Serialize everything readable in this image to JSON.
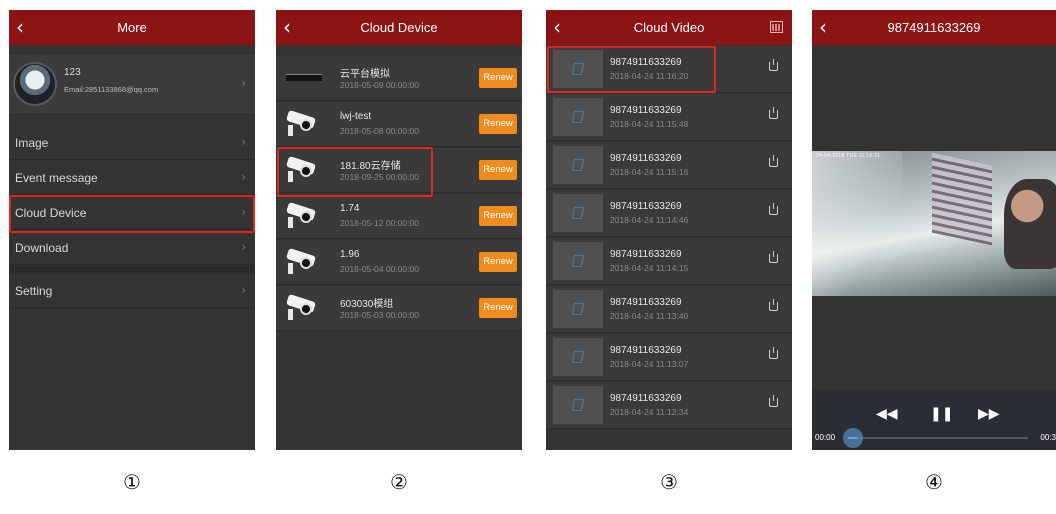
{
  "screens": [
    {
      "title": "More",
      "back_icon": "‹",
      "profile": {
        "name": "123",
        "email": "Email:2851133868@qq.com"
      },
      "menu": [
        "Image",
        "Event message",
        "Cloud Device",
        "Download",
        "Setting"
      ],
      "highlighted": "Cloud Device",
      "step": "①"
    },
    {
      "title": "Cloud Device",
      "back_icon": "‹",
      "devices": [
        {
          "name": "云平台模拟",
          "date": "2018-05-09 00:00:00",
          "action": "Renew",
          "icon": "dvr-icon"
        },
        {
          "name": "lwj-test",
          "date": "2018-05-08 00:00:00",
          "action": "Renew",
          "icon": "camera-icon"
        },
        {
          "name": "181.80云存储",
          "date": "2018-09-25 00:00:00",
          "action": "Renew",
          "icon": "camera-icon"
        },
        {
          "name": "1.74",
          "date": "2018-05-12 00:00:00",
          "action": "Renew",
          "icon": "camera-icon"
        },
        {
          "name": "1.96",
          "date": "2018-05-04 00:00:00",
          "action": "Renew",
          "icon": "camera-icon"
        },
        {
          "name": "603030模组",
          "date": "2018-05-03 00:00:00",
          "action": "Renew",
          "icon": "camera-icon"
        }
      ],
      "highlighted": "181.80云存储",
      "step": "②"
    },
    {
      "title": "Cloud Video",
      "back_icon": "‹",
      "videos": [
        {
          "name": "9874911633269",
          "date": "2018-04-24 11:16:20"
        },
        {
          "name": "9874911633269",
          "date": "2018-04-24 11:15:48"
        },
        {
          "name": "9874911633269",
          "date": "2018-04-24 11:15:16"
        },
        {
          "name": "9874911633269",
          "date": "2018-04-24 11:14:46"
        },
        {
          "name": "9874911633269",
          "date": "2018-04-24 11:14:15"
        },
        {
          "name": "9874911633269",
          "date": "2018-04-24 11:13:40"
        },
        {
          "name": "9874911633269",
          "date": "2018-04-24 11:13:07"
        },
        {
          "name": "9874911633269",
          "date": "2018-04-24 11:12:34"
        }
      ],
      "step": "③"
    },
    {
      "title": "9874911633269",
      "back_icon": "‹",
      "video_osd": "24-04-2018 TUE 11:16:21",
      "controls": {
        "rewind": "◀◀",
        "pause": "❚❚",
        "forward": "▶▶"
      },
      "time_start": "00:00",
      "time_end": "00:3",
      "progress": 0.05,
      "step": "④"
    }
  ],
  "colors": {
    "nav": "#8c1414",
    "renew": "#f08c1e",
    "highlight": "#e0251e",
    "background": "#333333"
  }
}
